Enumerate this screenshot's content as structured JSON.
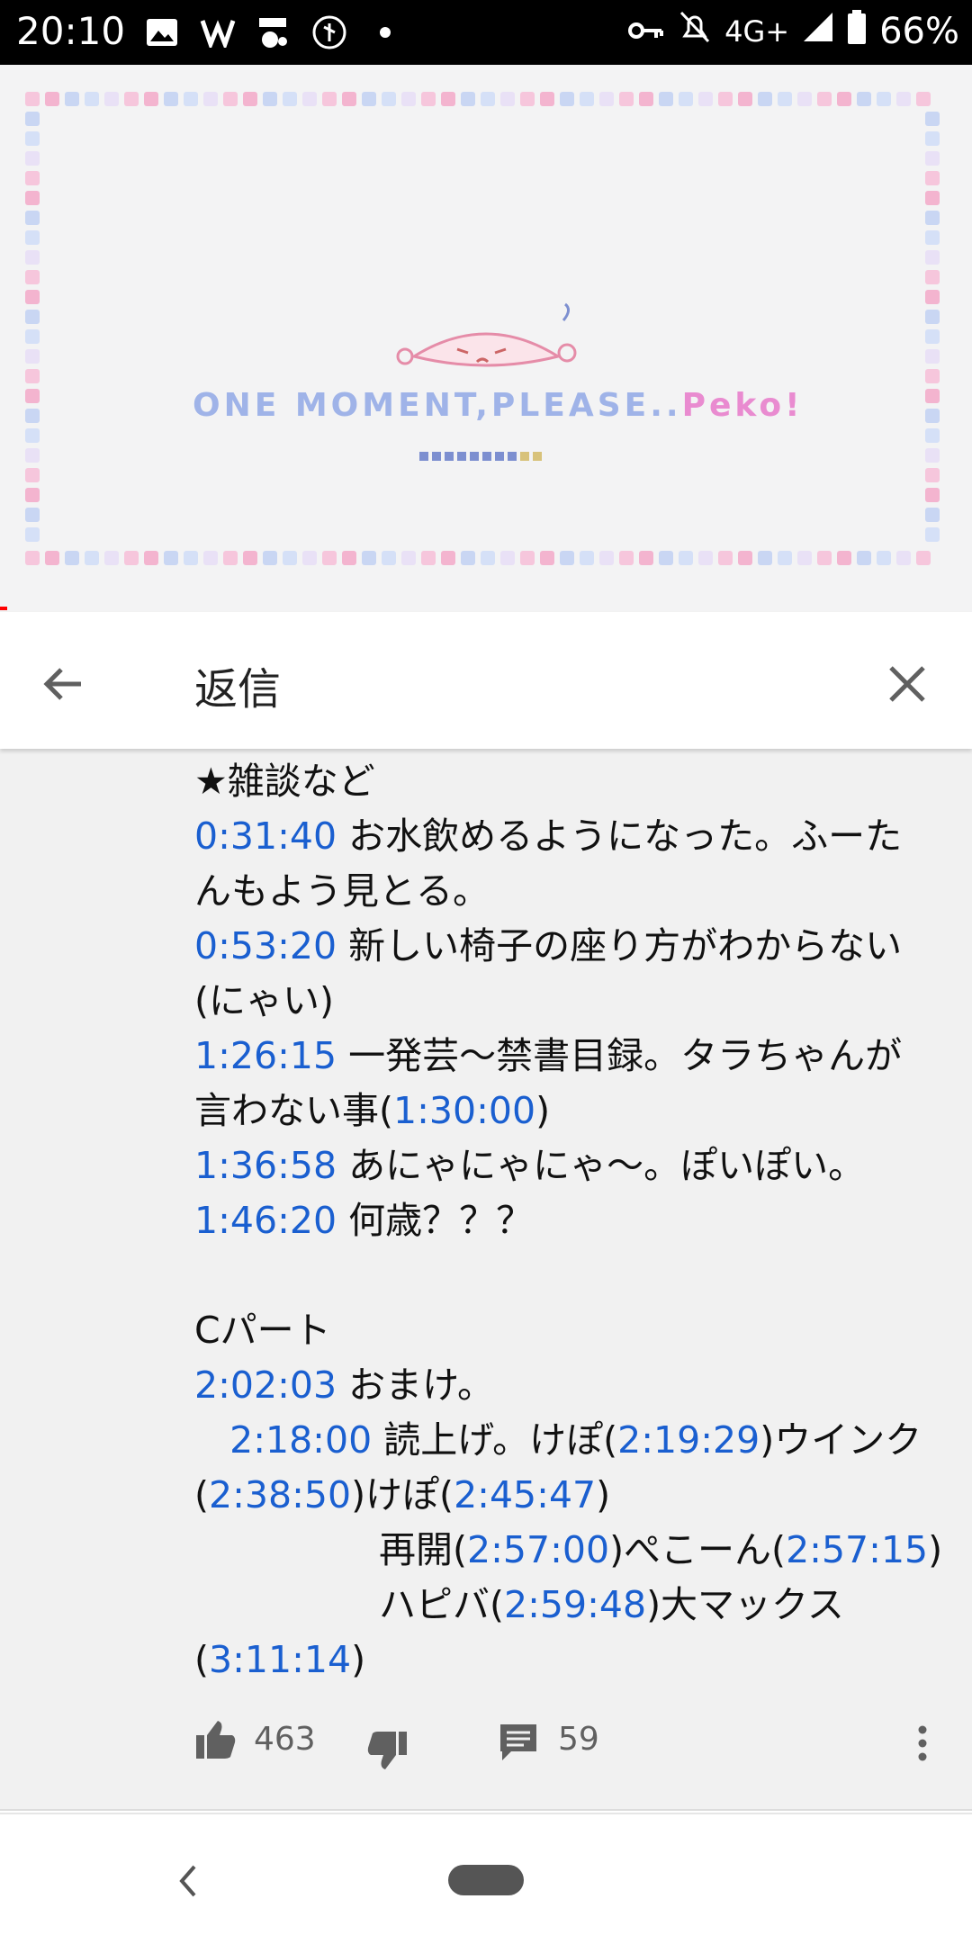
{
  "status_bar": {
    "time": "20:10",
    "network": "4G+",
    "battery": "66%",
    "icons": [
      "image-icon",
      "app-icon-wn",
      "app-icon-jimoty",
      "app-icon-ya",
      "notification-dot-icon",
      "vpn-key-icon",
      "bell-off-icon",
      "signal-icon",
      "battery-icon"
    ]
  },
  "video": {
    "title_main": "ONE MOMENT,PLEASE..",
    "title_suffix": "Peko!"
  },
  "header": {
    "title": "返信",
    "back_icon": "arrow-left-icon",
    "close_icon": "close-icon"
  },
  "comment": {
    "lines": [
      [
        {
          "t": "★雑談など"
        }
      ],
      [
        {
          "ts": "0:31:40"
        },
        {
          "t": " お水飲めるようになった。ふーた"
        }
      ],
      [
        {
          "t": "んもよう見とる。"
        }
      ],
      [
        {
          "ts": "0:53:20"
        },
        {
          "t": " 新しい椅子の座り方がわからない"
        }
      ],
      [
        {
          "t": "(にゃい)"
        }
      ],
      [
        {
          "ts": "1:26:15"
        },
        {
          "t": " 一発芸〜禁書目録。タラちゃんが"
        }
      ],
      [
        {
          "t": "言わない事("
        },
        {
          "ts": "1:30:00"
        },
        {
          "t": ")"
        }
      ],
      [
        {
          "ts": "1:36:58"
        },
        {
          "t": " あにゃにゃにゃ〜。ぽいぽい。"
        }
      ],
      [
        {
          "ts": "1:46:20"
        },
        {
          "t": " 何歳？？？"
        }
      ],
      [
        {
          "t": ""
        }
      ],
      [
        {
          "t": "Cパート"
        }
      ],
      [
        {
          "ts": "2:02:03"
        },
        {
          "t": " おまけ。"
        }
      ],
      [
        {
          "t": "   "
        },
        {
          "ts": "2:18:00"
        },
        {
          "t": " 読上げ。けぽ("
        },
        {
          "ts": "2:19:29"
        },
        {
          "t": ")ウインク"
        }
      ],
      [
        {
          "t": "("
        },
        {
          "ts": "2:38:50"
        },
        {
          "t": ")けぽ("
        },
        {
          "ts": "2:45:47"
        },
        {
          "t": ")"
        }
      ],
      [
        {
          "t": "　　　　　再開("
        },
        {
          "ts": "2:57:00"
        },
        {
          "t": ")ぺこーん("
        },
        {
          "ts": "2:57:15"
        },
        {
          "t": ")"
        }
      ],
      [
        {
          "t": "　　　　　ハピバ("
        },
        {
          "ts": "2:59:48"
        },
        {
          "t": ")大マックス"
        }
      ],
      [
        {
          "t": "("
        },
        {
          "ts": "3:11:14"
        },
        {
          "t": ")"
        }
      ]
    ],
    "like_count": "463",
    "reply_count": "59"
  },
  "colors": {
    "timestamp": "#1a5fd0",
    "background": "#f1f1f1",
    "progress": "#ff0000"
  }
}
